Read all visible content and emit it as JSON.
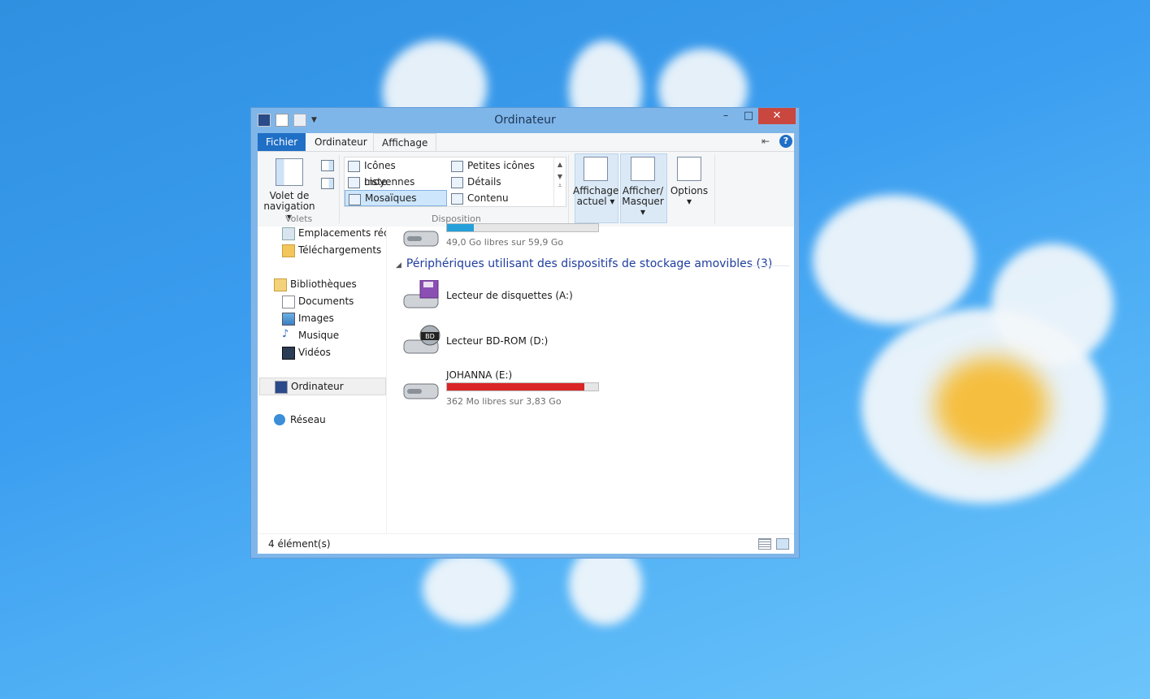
{
  "window": {
    "title": "Ordinateur"
  },
  "ribbon": {
    "tabs": [
      "Fichier",
      "Ordinateur",
      "Affichage"
    ],
    "volets": {
      "nav_label_1": "Volet de",
      "nav_label_2": "navigation",
      "group": "Volets"
    },
    "disposition": {
      "group": "Disposition",
      "items": [
        "Icônes moyennes",
        "Petites icônes",
        "Liste",
        "Détails",
        "Mosaïques",
        "Contenu"
      ]
    },
    "affichage_actuel": {
      "line1": "Affichage",
      "line2": "actuel"
    },
    "afficher_masquer": {
      "line1": "Afficher/",
      "line2": "Masquer"
    },
    "options": {
      "label": "Options"
    }
  },
  "nav": {
    "items": [
      "Emplacements récents",
      "Téléchargements",
      "Bibliothèques",
      "Documents",
      "Images",
      "Musique",
      "Vidéos",
      "Ordinateur",
      "Réseau"
    ]
  },
  "main": {
    "first_drive": {
      "free": "49,0 Go libres sur 59,9 Go",
      "used_fraction": 0.18
    },
    "group_header": "Périphériques utilisant des dispositifs de stockage amovibles (3)",
    "drives": [
      {
        "name": "Lecteur de disquettes (A:)"
      },
      {
        "name": "Lecteur BD-ROM (D:)"
      },
      {
        "name": "JOHANNA (E:)",
        "free": "362 Mo libres sur 3,83 Go",
        "used_fraction": 0.91
      }
    ]
  },
  "status": {
    "count": "4 élément(s)"
  },
  "colors": {
    "accent": "#1f6fc6",
    "drive_ok": "#26a0da",
    "drive_full": "#da2626"
  }
}
